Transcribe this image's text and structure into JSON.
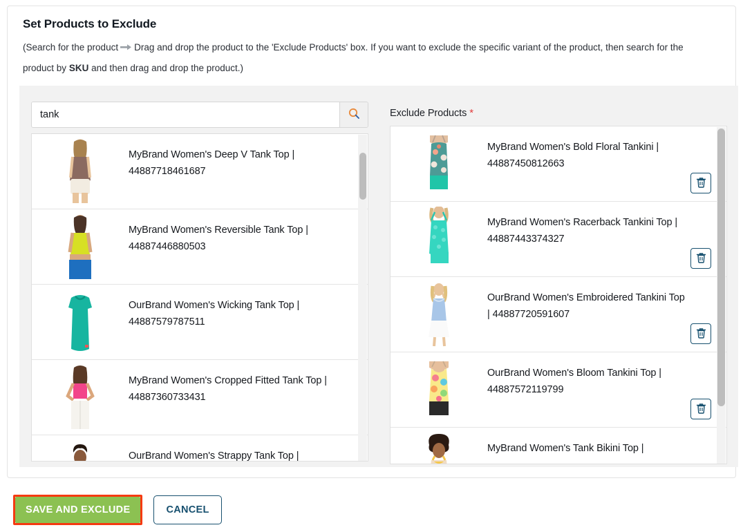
{
  "header": {
    "title": "Set Products to Exclude",
    "desc_part1": "(Search for the product",
    "desc_part2": "Drag and drop the product to the 'Exclude Products' box. If you want to exclude the specific variant of the product, then search for the product by",
    "desc_bold": "SKU",
    "desc_part3": "and then drag and drop the product.)",
    "arrow_icon": "arrow-right-icon"
  },
  "search": {
    "value": "tank",
    "placeholder": "",
    "button_icon": "search-icon"
  },
  "results": {
    "items": [
      {
        "name": "MyBrand Women's Deep V Tank Top |",
        "sku": "44887718461687"
      },
      {
        "name": "MyBrand Women's Reversible Tank Top |",
        "sku": "44887446880503"
      },
      {
        "name": "OurBrand Women's Wicking Tank Top |",
        "sku": "44887579787511"
      },
      {
        "name": "MyBrand Women's Cropped Fitted Tank Top |",
        "sku": "44887360733431"
      },
      {
        "name": "OurBrand Women's Strappy Tank Top |",
        "sku": ""
      }
    ]
  },
  "exclude": {
    "label": "Exclude Products",
    "required_mark": "*",
    "delete_icon": "trash-icon",
    "items": [
      {
        "name": "MyBrand Women's Bold Floral Tankini |",
        "sku": "44887450812663"
      },
      {
        "name": "MyBrand Women's Racerback Tankini Top |",
        "sku": "44887443374327"
      },
      {
        "name": "OurBrand Women's Embroidered Tankini Top |",
        "sku": "44887720591607"
      },
      {
        "name": "OurBrand Women's Bloom Tankini Top |",
        "sku": "44887572119799"
      },
      {
        "name": "MyBrand Women's Tank Bikini Top |",
        "sku": ""
      }
    ]
  },
  "footer": {
    "save_label": "SAVE AND EXCLUDE",
    "cancel_label": "CANCEL"
  },
  "colors": {
    "save_bg": "#8cc152",
    "save_highlight": "#f53a11",
    "cancel_border": "#17506f",
    "required": "#e23b3b"
  }
}
